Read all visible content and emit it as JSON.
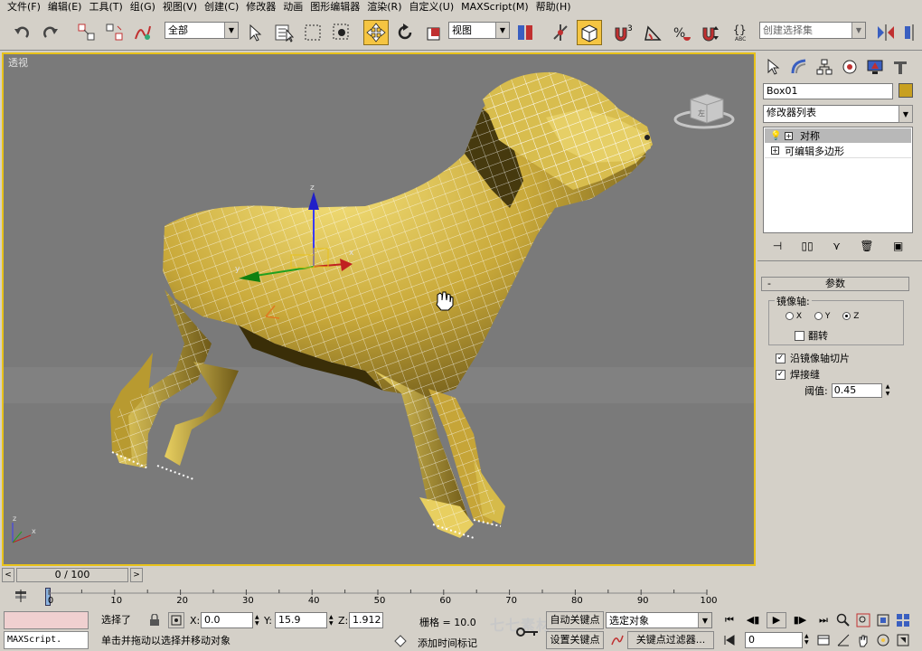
{
  "menu": [
    "文件(F)",
    "编辑(E)",
    "工具(T)",
    "组(G)",
    "视图(V)",
    "创建(C)",
    "修改器",
    "动画",
    "图形编辑器",
    "渲染(R)",
    "自定义(U)",
    "MAXScript(M)",
    "帮助(H)"
  ],
  "toolbar": {
    "selection_filter": "全部",
    "ref_coord": "视图",
    "named_selection": "创建选择集"
  },
  "viewport": {
    "label": "透视"
  },
  "command_panel": {
    "object_name": "Box01",
    "object_color": "#c8a020",
    "modifier_list": "修改器列表",
    "stack": [
      "对称",
      "可编辑多边形"
    ],
    "rollout_title": "参数",
    "mirror_axis_label": "镜像轴:",
    "axis_options": [
      "X",
      "Y",
      "Z"
    ],
    "axis_selected": "Z",
    "flip_label": "翻转",
    "slice_label": "沿镜像轴切片",
    "weld_label": "焊接缝",
    "threshold_label": "阈值:",
    "threshold_value": "0.45"
  },
  "time": {
    "slider_text": "0 / 100",
    "ticks": [
      "0",
      "10",
      "20",
      "30",
      "40",
      "50",
      "60",
      "70",
      "80",
      "90",
      "100"
    ]
  },
  "status": {
    "maxscript": "MAXScript.",
    "selected": "选择了",
    "prompt": "单击并拖动以选择并移动对象",
    "x_label": "X:",
    "x_value": "0.0",
    "y_label": "Y:",
    "y_value": "15.9",
    "z_label": "Z:",
    "z_value": "1.912",
    "grid_label": "栅格 = 10.0",
    "add_time_tag": "添加时间标记",
    "auto_key": "自动关键点",
    "set_key": "设置关键点",
    "key_mode": "选定对象",
    "key_filters": "关键点过滤器...",
    "frame_value": "0",
    "watermark": "七七素材"
  },
  "colors": {
    "accent": "#f5c542",
    "viewport_bg": "#7a7a7a",
    "model": "#c9a93a"
  }
}
